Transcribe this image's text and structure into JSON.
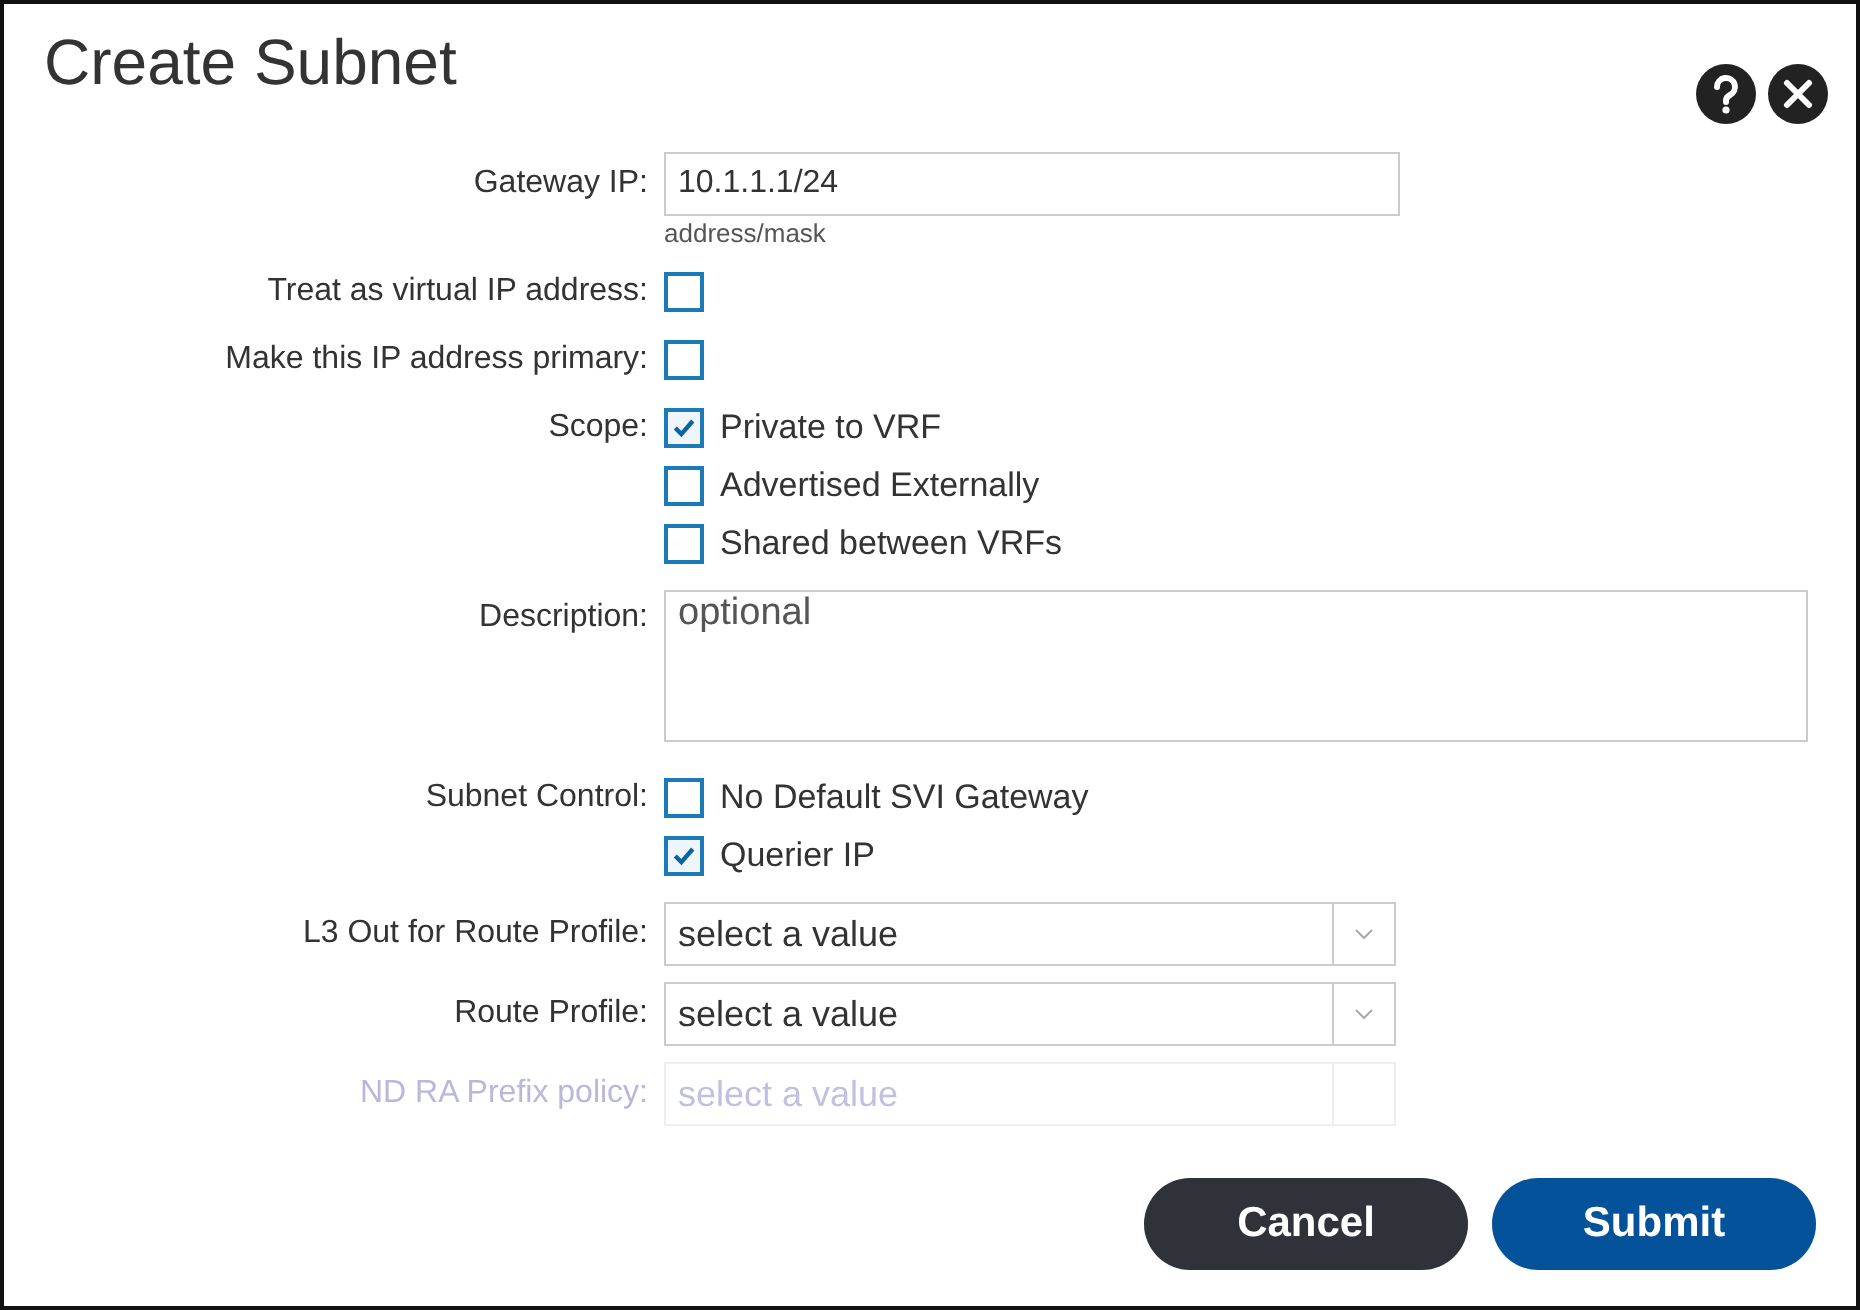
{
  "dialog": {
    "title": "Create Subnet"
  },
  "fields": [
    {
      "kind": "text",
      "label": "Gateway IP:",
      "value": "10.1.1.1/24",
      "hint": "address/mask"
    },
    {
      "kind": "checkbox",
      "label": "Treat as virtual IP address:",
      "checked": false
    },
    {
      "kind": "checkbox",
      "label": "Make this IP address primary:",
      "checked": false
    },
    {
      "kind": "checklist",
      "label": "Scope:",
      "options": [
        {
          "label": "Private to VRF",
          "checked": true
        },
        {
          "label": "Advertised Externally",
          "checked": false
        },
        {
          "label": "Shared between VRFs",
          "checked": false
        }
      ]
    },
    {
      "kind": "textarea",
      "label": "Description:",
      "placeholder": "optional"
    },
    {
      "kind": "checklist",
      "label": "Subnet Control:",
      "options": [
        {
          "label": "No Default SVI Gateway",
          "checked": false
        },
        {
          "label": "Querier IP",
          "checked": true
        }
      ]
    },
    {
      "kind": "select",
      "label": "L3 Out for Route Profile:",
      "placeholder": "select a value",
      "disabled": false
    },
    {
      "kind": "select",
      "label": "Route Profile:",
      "placeholder": "select a value",
      "disabled": false
    },
    {
      "kind": "select",
      "label": "ND RA Prefix policy:",
      "placeholder": "select a value",
      "disabled": true
    }
  ],
  "buttons": [
    {
      "label": "Cancel",
      "kind": "secondary"
    },
    {
      "label": "Submit",
      "kind": "primary"
    }
  ]
}
